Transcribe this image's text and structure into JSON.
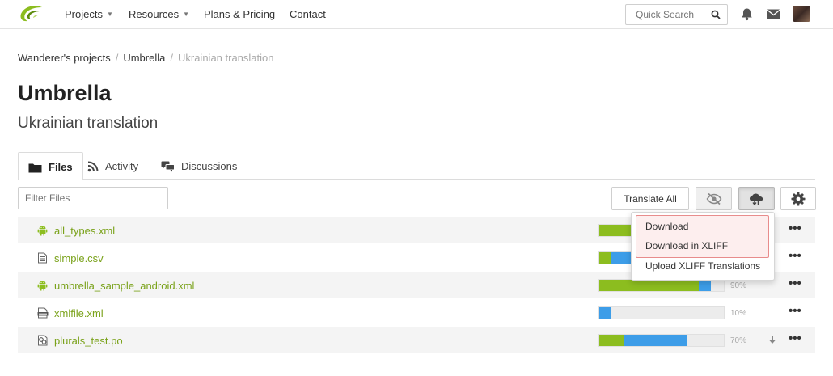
{
  "nav": {
    "items": [
      {
        "label": "Projects",
        "caret": true
      },
      {
        "label": "Resources",
        "caret": true
      },
      {
        "label": "Plans & Pricing",
        "caret": false
      },
      {
        "label": "Contact",
        "caret": false
      }
    ],
    "search_placeholder": "Quick Search"
  },
  "breadcrumb": [
    "Wanderer's projects",
    "Umbrella",
    "Ukrainian translation"
  ],
  "page": {
    "title": "Umbrella",
    "subtitle": "Ukrainian translation"
  },
  "tabs": [
    {
      "label": "Files",
      "icon": "folder-icon",
      "active": true
    },
    {
      "label": "Activity",
      "icon": "rss-icon",
      "active": false
    },
    {
      "label": "Discussions",
      "icon": "discussion-icon",
      "active": false
    }
  ],
  "toolbar": {
    "filter_placeholder": "Filter Files",
    "translate_all_label": "Translate All"
  },
  "files": [
    {
      "name": "all_types.xml",
      "icon": "android-icon",
      "translated": 0.26,
      "approved": 0.0,
      "percent": ""
    },
    {
      "name": "simple.csv",
      "icon": "csv-icon",
      "translated": 0.1,
      "approved": 0.9,
      "percent": ""
    },
    {
      "name": "umbrella_sample_android.xml",
      "icon": "android-icon",
      "translated": 0.8,
      "approved": 0.1,
      "percent": "90%"
    },
    {
      "name": "xmlfile.xml",
      "icon": "xml-icon",
      "translated": 0.0,
      "approved": 0.1,
      "percent": "10%"
    },
    {
      "name": "plurals_test.po",
      "icon": "po-icon",
      "translated": 0.2,
      "approved": 0.5,
      "percent": "70%"
    }
  ],
  "dropdown": {
    "items": [
      "Download",
      "Download in XLIFF",
      "Upload XLIFF Translations"
    ]
  },
  "colors": {
    "translated": "#8cbd1f",
    "approved": "#3d9de8",
    "file_link": "#7aa21a",
    "highlight_border": "#e88c8c"
  }
}
